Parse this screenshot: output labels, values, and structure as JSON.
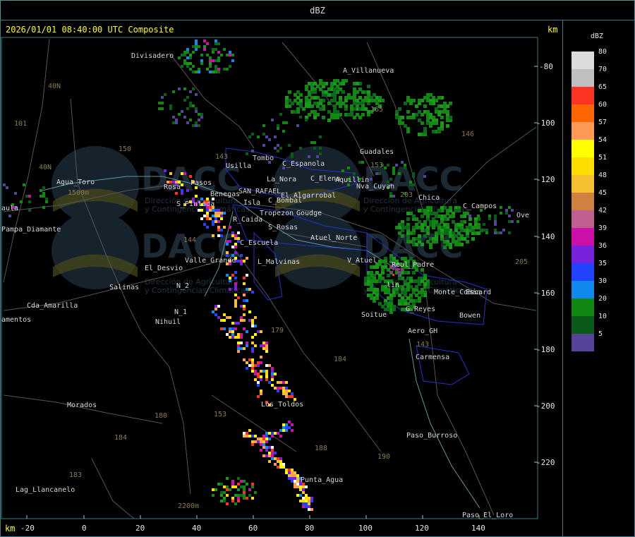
{
  "header": {
    "title": "dBZ"
  },
  "map": {
    "timestamp": "2026/01/01 08:40:00 UTC Composite",
    "unit_top": "km",
    "unit_bottom": "km",
    "y_ticks": [
      "-80",
      "-100",
      "-120",
      "-140",
      "-160",
      "-180",
      "-200",
      "-220"
    ],
    "x_ticks": [
      "-20",
      "0",
      "20",
      "40",
      "60",
      "80",
      "100",
      "120",
      "140"
    ],
    "place_labels": [
      "Divisadero",
      "A_Villanueva",
      "Guadales",
      "Tombo",
      "Usilla",
      "C_Espanola",
      "C_Elena",
      "Aquillin",
      "Nva_Cuyan",
      "La_Nora",
      "SAN_RAFAEL",
      "El_Algarrobal",
      "C_Bombal",
      "Tropezon",
      "Goudge",
      "R_Caida",
      "S_Rosas",
      "Atuel_Norte",
      "C_Escuela",
      "V_Atuel",
      "Real_Padre",
      "El_Desvio",
      "Valle_Grande",
      "L_Malvinas",
      "Salinas",
      "N_2",
      "N_1",
      "Nihuil",
      "Soitue",
      "G_Reyes",
      "Bowen",
      "Monte_Comán",
      "Escard",
      "Aero_GH",
      "Carmensa",
      "Los_Toldos",
      "Morados",
      "Paso_Burroso",
      "Punta_Agua",
      "Paso_El_Loro",
      "Lag_Llancanelo",
      "Pampa_Diamante",
      "Agua_Toro",
      "C_Campos",
      "Ove",
      "Cda_Amarilla",
      "amentos",
      "aula",
      "Rosa",
      "S_Pintada",
      "Benegas",
      "Pasos",
      "Isla",
      "lin",
      "Chica"
    ],
    "route_labels": [
      "40N",
      "40N",
      "101",
      "150",
      "153",
      "146",
      "143",
      "144",
      "179",
      "184",
      "180",
      "184",
      "183",
      "188",
      "190",
      "203",
      "153",
      "143",
      "165",
      "205",
      "1500m",
      "2200m"
    ],
    "watermark": {
      "brand": "DACC",
      "subtitle_1": "Dirección de Agricultura",
      "subtitle_2": "y Contingencias Climáticas"
    }
  },
  "legend": {
    "title": "dBZ",
    "items": [
      {
        "label": "80",
        "color": "#dcdcdc"
      },
      {
        "label": "70",
        "color": "#bfbfbf"
      },
      {
        "label": "65",
        "color": "#ff3322"
      },
      {
        "label": "60",
        "color": "#ff6600"
      },
      {
        "label": "57",
        "color": "#ff9955"
      },
      {
        "label": "54",
        "color": "#ffff00"
      },
      {
        "label": "51",
        "color": "#ffdd00"
      },
      {
        "label": "48",
        "color": "#f4c030"
      },
      {
        "label": "45",
        "color": "#d08040"
      },
      {
        "label": "42",
        "color": "#c06090"
      },
      {
        "label": "39",
        "color": "#cc11aa"
      },
      {
        "label": "36",
        "color": "#7722dd"
      },
      {
        "label": "35",
        "color": "#2244ff"
      },
      {
        "label": "30",
        "color": "#1188ee"
      },
      {
        "label": "20",
        "color": "#118811"
      },
      {
        "label": "10",
        "color": "#0a5a1a"
      },
      {
        "label": "5",
        "color": "#554499"
      }
    ]
  }
}
